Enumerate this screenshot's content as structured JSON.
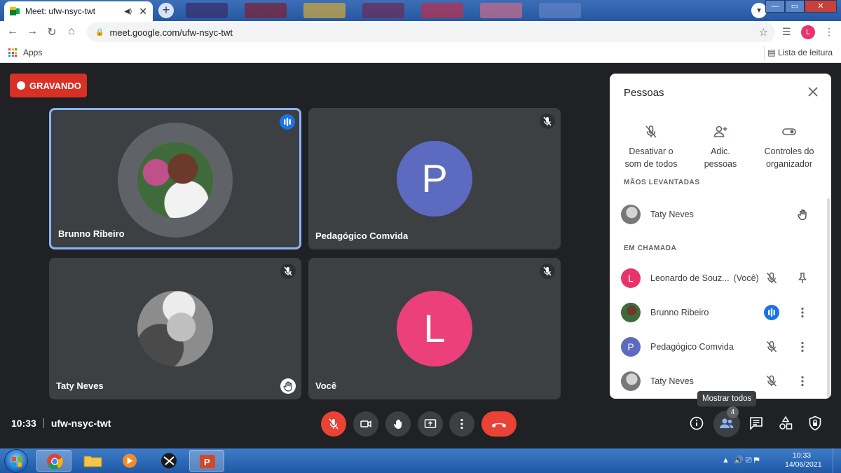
{
  "browser": {
    "tab_title": "Meet: ufw-nsyc-twt",
    "url": "meet.google.com/ufw-nsyc-twt",
    "profile_initial": "L",
    "bookmark_apps": "Apps",
    "reading_list": "Lista de leitura"
  },
  "meet": {
    "recording_label": "GRAVANDO",
    "time": "10:33",
    "meeting_code": "ufw-nsyc-twt",
    "tiles": [
      {
        "name": "Brunno Ribeiro",
        "state": "speaking"
      },
      {
        "name": "Pedagógico Comvida",
        "initial": "P",
        "color": "#5c6bc0",
        "state": "muted"
      },
      {
        "name": "Taty Neves",
        "state": "hand-raised"
      },
      {
        "name": "Você",
        "initial": "L",
        "color": "#ec407a",
        "state": "muted"
      }
    ]
  },
  "people_panel": {
    "title": "Pessoas",
    "actions": [
      {
        "line1": "Desativar o",
        "line2": "som de todos",
        "icon": "mic-off-icon"
      },
      {
        "line1": "Adic.",
        "line2": "pessoas",
        "icon": "person-add-icon"
      },
      {
        "line1": "Controles do",
        "line2": "organizador",
        "icon": "toggle-icon"
      }
    ],
    "section_raised": "MÃOS LEVANTADAS",
    "raised": [
      {
        "name": "Taty Neves"
      }
    ],
    "section_call": "EM CHAMADA",
    "in_call": [
      {
        "name": "Leonardo de Souz...",
        "tag": "(Você)",
        "initial": "L",
        "color": "#e8336f"
      },
      {
        "name": "Brunno Ribeiro"
      },
      {
        "name": "Pedagógico Comvida",
        "initial": "P",
        "color": "#5c6bc0"
      },
      {
        "name": "Taty Neves"
      }
    ]
  },
  "bottom_bar": {
    "people_count": "4",
    "tooltip": "Mostrar todos"
  },
  "taskbar": {
    "time": "10:33",
    "date": "14/06/2021"
  },
  "colors": {
    "meet_bg": "#202124",
    "tile_bg": "#3c4043",
    "accent_blue": "#1a73e8",
    "danger_red": "#ea4335"
  }
}
